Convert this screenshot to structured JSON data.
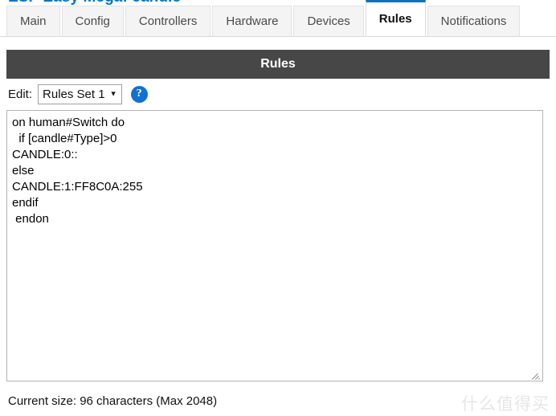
{
  "page": {
    "title": "ESP Easy Mega: candle",
    "title_color": "#0076c8"
  },
  "tabbar": {
    "active": "Rules",
    "active_indicator_color": "#0d72c4",
    "tabs": [
      {
        "label": "Main",
        "active": false
      },
      {
        "label": "Config",
        "active": false
      },
      {
        "label": "Controllers",
        "active": false
      },
      {
        "label": "Hardware",
        "active": false
      },
      {
        "label": "Devices",
        "active": false
      },
      {
        "label": "Rules",
        "active": true
      },
      {
        "label": "Notifications",
        "active": false
      }
    ]
  },
  "section": {
    "header": "Rules",
    "header_bg": "#474747",
    "header_fg": "#ffffff"
  },
  "edit_row": {
    "label": "Edit:",
    "select": {
      "selected": "Rules Set 1",
      "caret": "▼",
      "options": [
        "Rules Set 1"
      ]
    },
    "help": {
      "glyph": "?",
      "color": "#1271d2"
    }
  },
  "editor": {
    "content": "on human#Switch do\n  if [candle#Type]>0\nCANDLE:0::\nelse\nCANDLE:1:FF8C0A:255\nendif\n endon",
    "lines": [
      "on human#Switch do",
      "  if [candle#Type]>0",
      "CANDLE:0::",
      "else",
      "CANDLE:1:FF8C0A:255",
      "endif",
      " endon"
    ]
  },
  "footer": {
    "status": "Current size: 96 characters (Max 2048)",
    "current_size": 96,
    "max_size": 2048,
    "watermark": "什么值得买"
  }
}
